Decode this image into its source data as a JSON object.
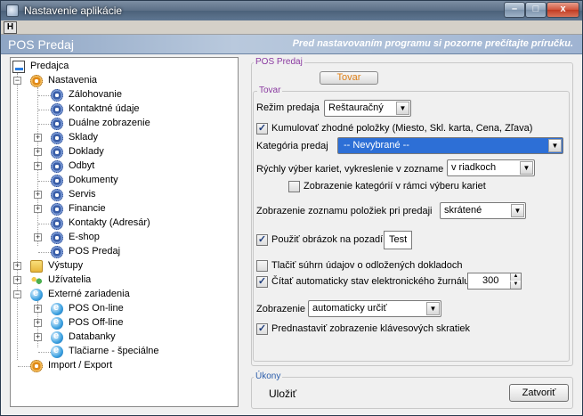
{
  "window": {
    "title": "Nastavenie aplikácie",
    "hbtn": "H",
    "controls": {
      "minimize": "–",
      "maximize": "□",
      "close": "x"
    }
  },
  "header": {
    "title": "POS Predaj",
    "note": "Pred nastavovaním programu si pozorne prečítajte príručku."
  },
  "tree": {
    "root": "Predajca",
    "nastavenia": "Nastavenia",
    "items": [
      "Zálohovanie",
      "Kontaktné údaje",
      "Duálne zobrazenie",
      "Sklady",
      "Doklady",
      "Odbyt",
      "Dokumenty",
      "Servis",
      "Financie",
      "Kontakty (Adresár)",
      "E-shop",
      "POS Predaj"
    ],
    "vystupy": "Výstupy",
    "uzivatelia": "Užívatelia",
    "externe": "Externé zariadenia",
    "ext_items": [
      "POS On-line",
      "POS Off-line",
      "Databanky",
      "Tlačiarne - špeciálne"
    ],
    "import": "Import / Export"
  },
  "pos_group": {
    "legend": "POS Predaj",
    "tab": "Tovar"
  },
  "tovar": {
    "legend": "Tovar",
    "rezim_label": "Režim predaja",
    "rezim_value": "Reštauračný",
    "kumulovat": "Kumulovať zhodné položky (Miesto, Skl. karta, Cena, Zľava)",
    "kategoria_label": "Kategória predaj",
    "kategoria_value": "-- Nevybrané --",
    "rychly_label": "Rýchly výber kariet, vykreslenie v zozname",
    "rychly_value": "v riadkoch",
    "zobrazenie_kat": "Zobrazenie kategórií v rámci výberu kariet",
    "zoznam_label": "Zobrazenie zoznamu položiek pri predaji",
    "zoznam_value": "skrátené",
    "obrazok": "Použiť obrázok na pozadí",
    "test": "Test",
    "tlacit": "Tlačiť súhrn údajov o odložených dokladoch",
    "citat": "Čítať automaticky stav elektronického žurnálu",
    "citat_value": "300",
    "zobrazenie_label": "Zobrazenie",
    "zobrazenie_value": "automaticky určiť",
    "prednastavit": "Prednastaviť zobrazenie klávesových skratiek"
  },
  "ukony": {
    "legend": "Úkony",
    "ulozit": "Uložiť",
    "zatvorit": "Zatvoriť"
  },
  "checks": {
    "kumulovat": true,
    "zobrazenie_kat": false,
    "obrazok": true,
    "tlacit": false,
    "citat": true,
    "prednastavit": true
  },
  "colors": {
    "selected": "#2d6fd6",
    "legend": "#8a3aa0",
    "tab_text": "#e08018"
  }
}
